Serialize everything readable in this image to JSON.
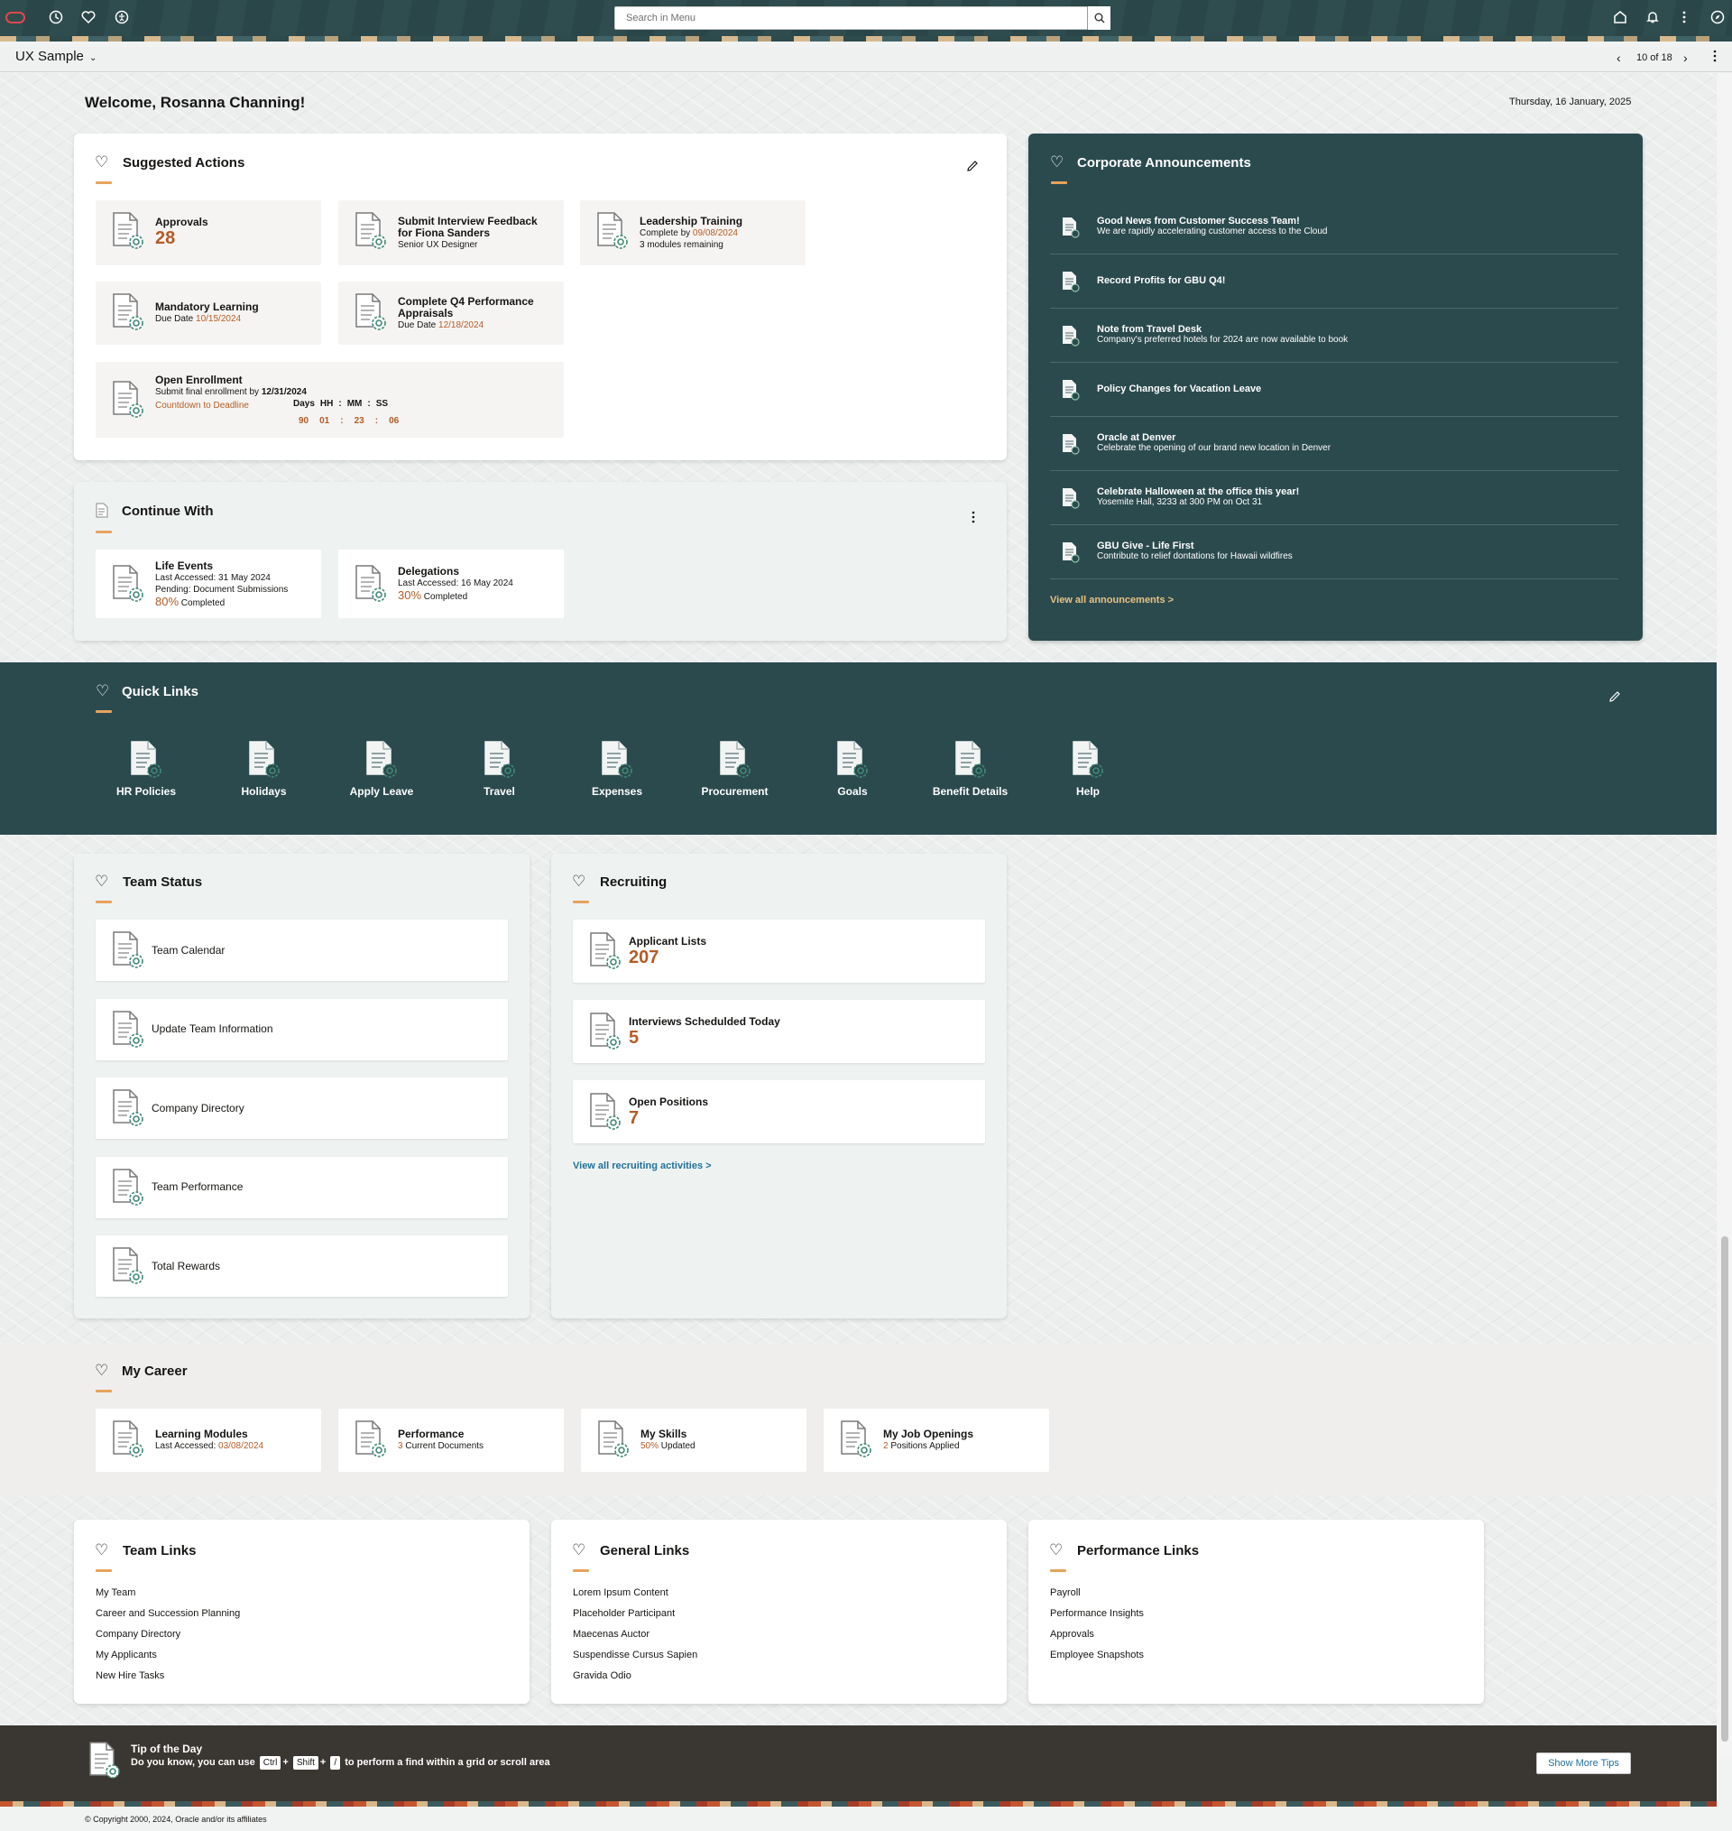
{
  "topbar": {
    "search_placeholder": "Search in Menu"
  },
  "subheader": {
    "title": "UX Sample",
    "pager": "10 of 18"
  },
  "welcome": "Welcome, Rosanna Channing!",
  "date": "Thursday, 16 January, 2025",
  "suggested_actions": {
    "title": "Suggested Actions",
    "approvals": {
      "title": "Approvals",
      "count": "28"
    },
    "interview": {
      "title1": "Submit Interview Feedback",
      "title2": "for Fiona Sanders",
      "sub": "Senior UX Designer"
    },
    "leadership": {
      "title": "Leadership Training",
      "sub_prefix": "Complete by ",
      "sub_date": "09/08/2024",
      "sub2": "3 modules remaining"
    },
    "mandatory": {
      "title": "Mandatory Learning",
      "sub_prefix": "Due Date ",
      "sub_date": "10/15/2024"
    },
    "appraisals": {
      "title1": "Complete Q4 Performance",
      "title2": "Appraisals",
      "sub_prefix": "Due Date ",
      "sub_date": "12/18/2024"
    },
    "enrollment": {
      "title": "Open Enrollment",
      "sub_prefix": "Submit final enrollment by ",
      "sub_date": "12/31/2024",
      "countdown_label": "Countdown to Deadline",
      "labels": [
        "Days",
        "HH",
        ":",
        "MM",
        ":",
        "SS"
      ],
      "values": [
        "90",
        "01",
        ":",
        "23",
        ":",
        "06"
      ]
    }
  },
  "continue_with": {
    "title": "Continue With",
    "life_events": {
      "title": "Life Events",
      "sub1": "Last Accessed: 31 May 2024",
      "sub2": "Pending: Document Submissions",
      "pct": "80%",
      "pct_label": " Completed"
    },
    "delegations": {
      "title": "Delegations",
      "sub1": "Last Accessed: 16 May 2024",
      "pct": "30%",
      "pct_label": " Completed"
    }
  },
  "announcements": {
    "title": "Corporate Announcements",
    "items": [
      {
        "title": "Good News from Customer Success Team!",
        "sub": "We are rapidly accelerating customer access to the Cloud"
      },
      {
        "title": "Record Profits for GBU Q4!",
        "sub": ""
      },
      {
        "title": "Note from Travel Desk",
        "sub": "Company's preferred hotels for 2024 are now available to book"
      },
      {
        "title": "Policy Changes for Vacation Leave",
        "sub": ""
      },
      {
        "title": "Oracle at Denver",
        "sub": "Celebrate the opening of our brand new location in Denver"
      },
      {
        "title": "Celebrate Halloween at the office this year!",
        "sub": "Yosemite Hall, 3233 at 300 PM on Oct 31"
      },
      {
        "title": "GBU Give - Life First",
        "sub": "Contribute to relief dontations for Hawaii wildfires"
      }
    ],
    "view_all": "View all announcements >"
  },
  "quick_links": {
    "title": "Quick Links",
    "items": [
      "HR Policies",
      "Holidays",
      "Apply Leave",
      "Travel",
      "Expenses",
      "Procurement",
      "Goals",
      "Benefit Details",
      "Help"
    ]
  },
  "team_status": {
    "title": "Team Status",
    "items": [
      "Team Calendar",
      "Update Team Information",
      "Company Directory",
      "Team Performance",
      "Total Rewards"
    ]
  },
  "recruiting": {
    "title": "Recruiting",
    "items": [
      {
        "title": "Applicant Lists",
        "count": "207"
      },
      {
        "title": "Interviews Schedulded Today",
        "count": "5"
      },
      {
        "title": "Open Positions",
        "count": "7"
      }
    ],
    "view_all": "View all recruiting activities >"
  },
  "my_career": {
    "title": "My Career",
    "items": [
      {
        "title": "Learning Modules",
        "sub_prefix": "Last Accessed: ",
        "sub_hl": "03/08/2024",
        "sub_suffix": ""
      },
      {
        "title": "Performance",
        "sub_prefix": "",
        "sub_hl": "3",
        "sub_suffix": " Current Documents"
      },
      {
        "title": "My Skills",
        "sub_prefix": "",
        "sub_hl": "50%",
        "sub_suffix": " Updated"
      },
      {
        "title": "My Job Openings",
        "sub_prefix": "",
        "sub_hl": "2",
        "sub_suffix": " Positions Applied"
      }
    ]
  },
  "team_links": {
    "title": "Team Links",
    "items": [
      "My Team",
      "Career and Succession Planning",
      "Company Directory",
      "My Applicants",
      "New Hire Tasks"
    ]
  },
  "general_links": {
    "title": "General Links",
    "items": [
      "Lorem Ipsum Content",
      "Placeholder Participant",
      "Maecenas Auctor",
      "Suspendisse Cursus Sapien",
      "Gravida Odio"
    ]
  },
  "performance_links": {
    "title": "Performance Links",
    "items": [
      "Payroll",
      "Performance Insights",
      "Approvals",
      "Employee Snapshots"
    ]
  },
  "tip": {
    "title": "Tip of the Day",
    "prefix": "Do you know, you can use",
    "key1": "Ctrl",
    "plus1": "+",
    "key2": "Shift",
    "plus2": "+",
    "key3": "/",
    "suffix": "to perform a find within a grid or scroll area",
    "button": "Show More Tips"
  },
  "copyright": "© Copyright 2000, 2024, Oracle and/or its affiliates",
  "colors": {
    "accent_orange": "#b45c26",
    "teal_dark": "#2b4a4e",
    "link_blue": "#227099",
    "underline_orange": "#e7a35b"
  }
}
